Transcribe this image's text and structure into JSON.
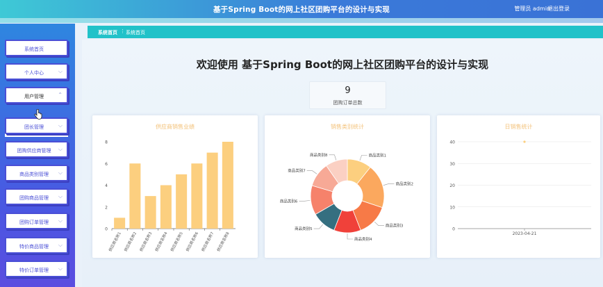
{
  "header": {
    "title": "基于Spring Boot的网上社区团购平台的设计与实现",
    "user": "管理员 admin",
    "logout": "退出登录"
  },
  "sidebar": {
    "items": [
      {
        "label": "系统首页",
        "chevron": false
      },
      {
        "label": "个人中心",
        "chevron": true
      },
      {
        "label": "用户管理",
        "chevron": true,
        "active": true
      },
      {
        "label": "团长管理",
        "chevron": true
      },
      {
        "label": "团购供应商管理",
        "chevron": true
      },
      {
        "label": "商品类别管理",
        "chevron": true
      },
      {
        "label": "团购商品管理",
        "chevron": true
      },
      {
        "label": "团购订单管理",
        "chevron": true
      },
      {
        "label": "特价商品管理",
        "chevron": true
      },
      {
        "label": "特价订单管理",
        "chevron": true
      }
    ]
  },
  "breadcrumb": {
    "home": "系统首页",
    "separator": "⋮",
    "current": "系统首页"
  },
  "main": {
    "title": "欢迎使用 基于Spring Boot的网上社区团购平台的设计与实现",
    "stat": {
      "value": "9",
      "caption": "团购订单总数"
    }
  },
  "colors": {
    "bar": "#fccf7f",
    "accent": "#21c2c9",
    "sidebar": "#4a4fd6"
  },
  "chart_data": [
    {
      "type": "bar",
      "title": "供应商销售业绩",
      "categories": [
        "供应商名称1",
        "供应商名称2",
        "供应商名称3",
        "供应商名称4",
        "供应商名称5",
        "供应商名称6",
        "供应商名称7",
        "供应商名称8"
      ],
      "values": [
        1,
        6,
        3,
        4,
        5,
        6,
        7,
        8
      ],
      "ylim": [
        0,
        8
      ],
      "yticks": [
        0,
        2,
        4,
        6,
        8
      ]
    },
    {
      "type": "pie",
      "title": "销售类别统计",
      "labels": [
        "商品类别1",
        "商品类别2",
        "商品类别3",
        "商品类别4",
        "商品类别5",
        "商品类别6",
        "商品类别7",
        "商品类别8"
      ],
      "values": [
        10,
        18,
        13,
        11,
        10,
        12,
        10,
        9
      ],
      "colors": [
        "#fccf7f",
        "#fba85e",
        "#f77a47",
        "#f0413a",
        "#356f80",
        "#f6826b",
        "#f7a996",
        "#fbd0c3"
      ]
    },
    {
      "type": "line",
      "title": "日销售统计",
      "x": [
        "2023-04-21"
      ],
      "values": [
        40
      ],
      "ylim": [
        0,
        40
      ],
      "yticks": [
        0,
        10,
        20,
        30,
        40
      ]
    }
  ]
}
